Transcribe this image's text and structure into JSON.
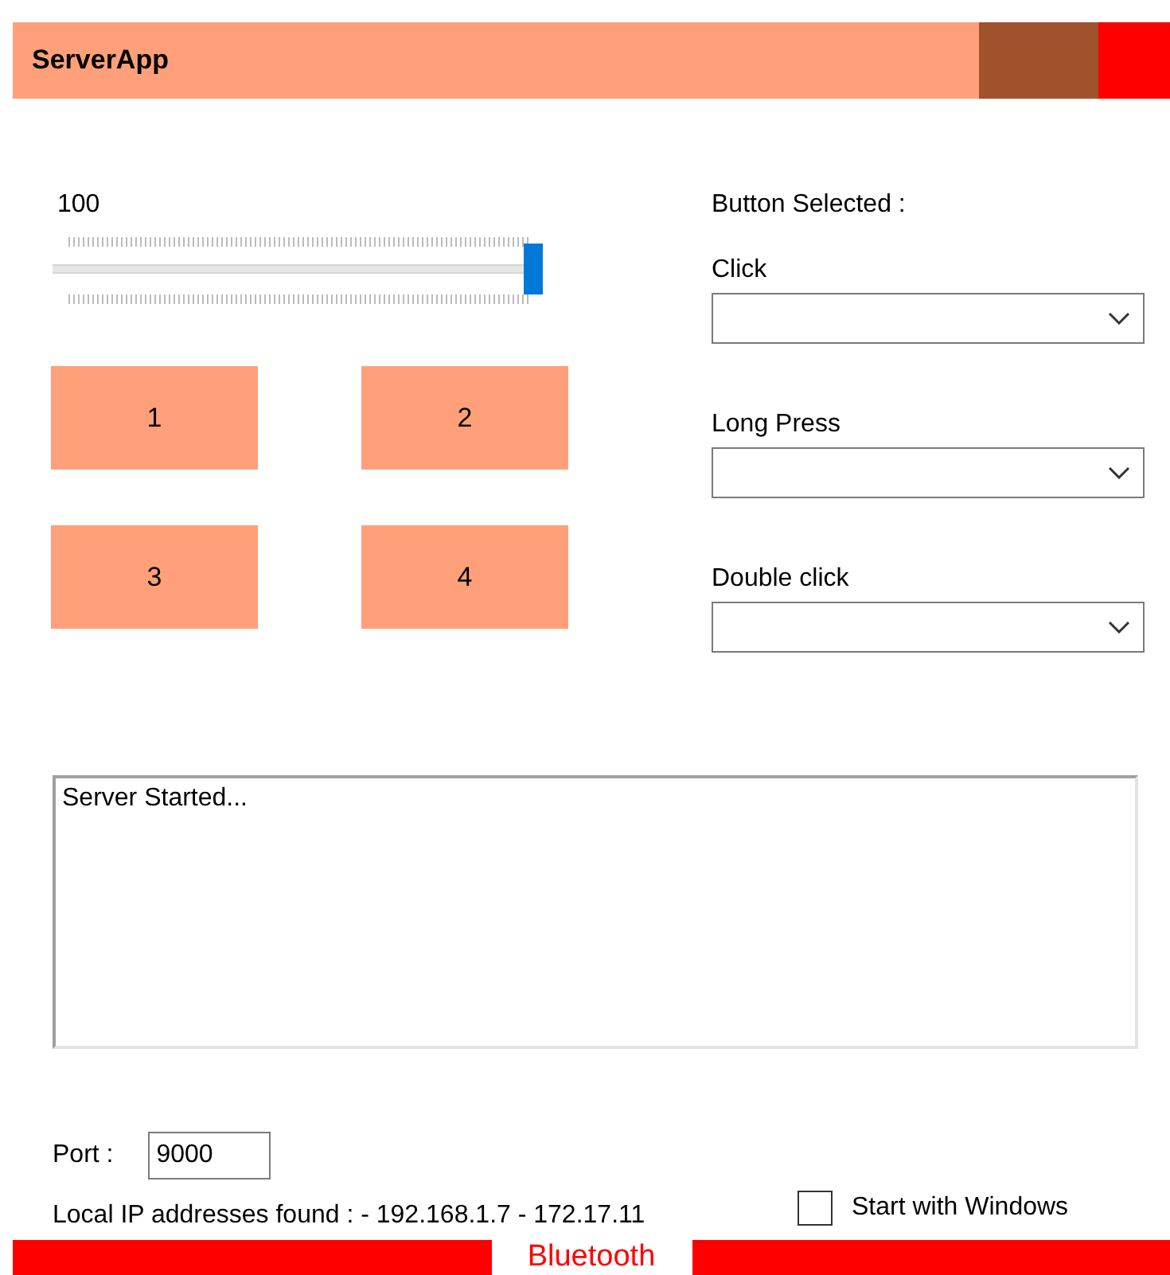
{
  "window": {
    "title": "ServerApp"
  },
  "slider": {
    "reading": "100",
    "level": 1.0
  },
  "buttons": [
    "1",
    "2",
    "3",
    "4"
  ],
  "button_selected": {
    "label": "Button Selected :",
    "dropdowns": [
      {
        "label": "Click"
      },
      {
        "label": "Long Press"
      },
      {
        "label": "Double click"
      }
    ]
  },
  "log": {
    "value": "Server Started..."
  },
  "port": {
    "label": "Port :",
    "value": "9000"
  },
  "local_ip": "Local IP addresses found : - 192.168.1.7 - 172.17.11",
  "start_with_windows": {
    "label": "Start with Windows",
    "checked": false
  },
  "bottom_bar": {
    "label": "Bluetooth"
  }
}
